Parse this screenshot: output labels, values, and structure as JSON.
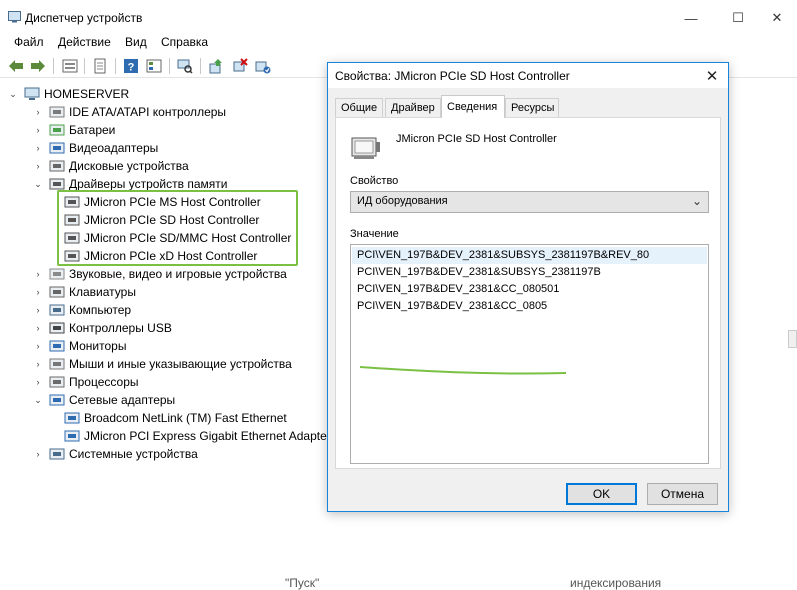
{
  "window": {
    "title": "Диспетчер устройств",
    "controls": {
      "minimize": "—",
      "maximize": "☐",
      "close": "✕"
    }
  },
  "menu": [
    "Файл",
    "Действие",
    "Вид",
    "Справка"
  ],
  "toolbar": {
    "icons": [
      "back-arrow-icon",
      "forward-arrow-icon",
      "show-hidden-icon",
      "properties-icon",
      "help-icon",
      "details-view-icon",
      "scan-hardware-icon",
      "update-driver-icon",
      "uninstall-icon",
      "enable-device-icon"
    ]
  },
  "tree": {
    "root": "HOMESERVER",
    "items": [
      {
        "label": "IDE ATA/ATAPI контроллеры",
        "icon": "ide-controller-icon",
        "expander": "collapsed"
      },
      {
        "label": "Батареи",
        "icon": "battery-icon",
        "expander": "collapsed"
      },
      {
        "label": "Видеоадаптеры",
        "icon": "display-adapter-icon",
        "expander": "collapsed"
      },
      {
        "label": "Дисковые устройства",
        "icon": "disk-drive-icon",
        "expander": "collapsed"
      },
      {
        "label": "Драйверы устройств памяти",
        "icon": "storage-controller-icon",
        "expander": "expanded"
      },
      {
        "label": "JMicron PCIe MS Host Controller",
        "icon": "controller-chip-icon",
        "expander": "none",
        "child": true
      },
      {
        "label": "JMicron PCIe SD Host Controller",
        "icon": "controller-chip-icon",
        "expander": "none",
        "child": true
      },
      {
        "label": "JMicron PCIe SD/MMC Host Controller",
        "icon": "controller-chip-icon",
        "expander": "none",
        "child": true
      },
      {
        "label": "JMicron PCIe xD Host Controller",
        "icon": "controller-chip-icon",
        "expander": "none",
        "child": true
      },
      {
        "label": "Звуковые, видео и игровые устройства",
        "icon": "sound-icon",
        "expander": "collapsed"
      },
      {
        "label": "Клавиатуры",
        "icon": "keyboard-icon",
        "expander": "collapsed"
      },
      {
        "label": "Компьютер",
        "icon": "computer-icon",
        "expander": "collapsed"
      },
      {
        "label": "Контроллеры USB",
        "icon": "usb-icon",
        "expander": "collapsed"
      },
      {
        "label": "Мониторы",
        "icon": "monitor-icon",
        "expander": "collapsed"
      },
      {
        "label": "Мыши и иные указывающие устройства",
        "icon": "mouse-icon",
        "expander": "collapsed"
      },
      {
        "label": "Процессоры",
        "icon": "processor-icon",
        "expander": "collapsed"
      },
      {
        "label": "Сетевые адаптеры",
        "icon": "network-adapter-icon",
        "expander": "expanded"
      },
      {
        "label": "Broadcom NetLink (TM) Fast Ethernet",
        "icon": "network-card-icon",
        "expander": "none",
        "child": true
      },
      {
        "label": "JMicron PCI Express Gigabit Ethernet Adapter",
        "icon": "network-card-icon",
        "expander": "none",
        "child": true
      },
      {
        "label": "Системные устройства",
        "icon": "system-devices-icon",
        "expander": "collapsed"
      }
    ]
  },
  "dialog": {
    "title": "Свойства: JMicron PCIe SD Host Controller",
    "close": "✕",
    "tabs": [
      "Общие",
      "Драйвер",
      "Сведения",
      "Ресурсы"
    ],
    "active_tab": "Сведения",
    "device_name": "JMicron PCIe SD Host Controller",
    "property_label": "Свойство",
    "property_selected": "ИД оборудования",
    "value_label": "Значение",
    "values": [
      "PCI\\VEN_197B&DEV_2381&SUBSYS_2381197B&REV_80",
      "PCI\\VEN_197B&DEV_2381&SUBSYS_2381197B",
      "PCI\\VEN_197B&DEV_2381&CC_080501",
      "PCI\\VEN_197B&DEV_2381&CC_0805"
    ],
    "selected_value_index": 0,
    "ok_label": "OK",
    "cancel_label": "Отмена"
  },
  "bottom": {
    "left_text": "\"Пуск\"",
    "right_text": "индексирования"
  },
  "colors": {
    "accent": "#0078d7",
    "highlight": "#7ac143",
    "selection": "#e5f1fb",
    "dialog_border": "#1883d7"
  }
}
